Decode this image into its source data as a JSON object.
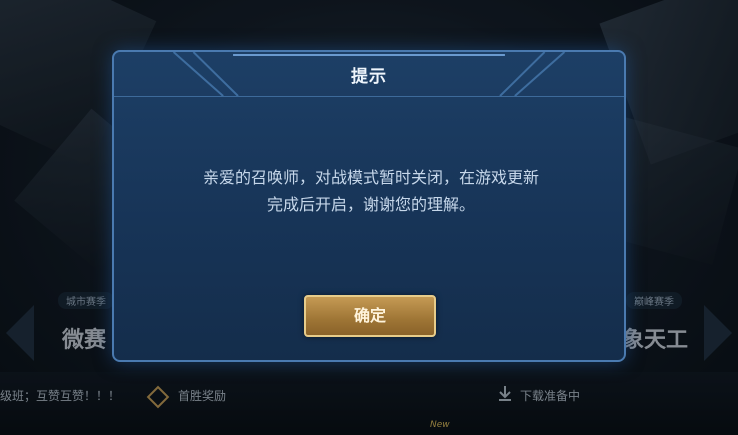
{
  "background": {
    "left_panel": {
      "tag": "城市赛季",
      "title": "微赛"
    },
    "right_panel": {
      "tag": "巅峰赛季",
      "title": "象天工"
    },
    "bottom": {
      "left_text": "级班；互赞互赞！！！",
      "mid_text": "首胜奖励",
      "right_text": "下载准备中",
      "new_badge": "New"
    }
  },
  "dialog": {
    "title": "提示",
    "message_line1": "亲爱的召唤师，对战模式暂时关闭，在游戏更新",
    "message_line2": "完成后开启，谢谢您的理解。",
    "ok_label": "确定"
  },
  "colors": {
    "dialog_bg": "#173457",
    "dialog_border": "#4a7ab0",
    "button_gold": "#b08544",
    "button_border": "#e7cc8a"
  }
}
